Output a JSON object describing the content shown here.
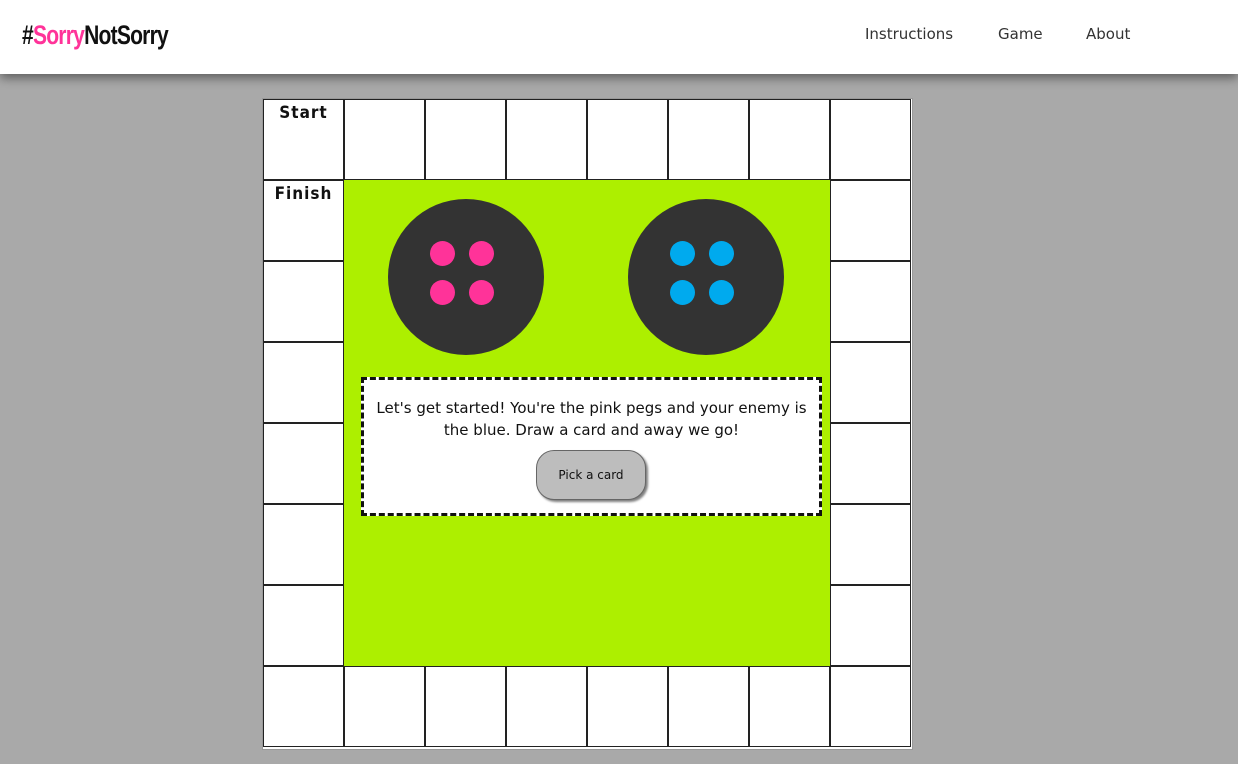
{
  "brand": {
    "hash": "#",
    "sorry": "Sorry",
    "not_sorry": "NotSorry"
  },
  "nav": {
    "items": [
      "Instructions",
      "Game",
      "About"
    ]
  },
  "board": {
    "start_label": "Start",
    "finish_label": "Finish",
    "homes": [
      {
        "player": "pink",
        "peg_color": "#ff3399",
        "pegs": 4
      },
      {
        "player": "blue",
        "peg_color": "#00aaee",
        "pegs": 4
      }
    ]
  },
  "message": {
    "text": "Let's get started! You're the pink pegs and your enemy is the blue. Draw a card and away we go!",
    "button_label": "Pick a card"
  },
  "colors": {
    "accent": "#ff3399",
    "center": "#adef00",
    "home": "#333333",
    "background": "#a9a9a9"
  }
}
